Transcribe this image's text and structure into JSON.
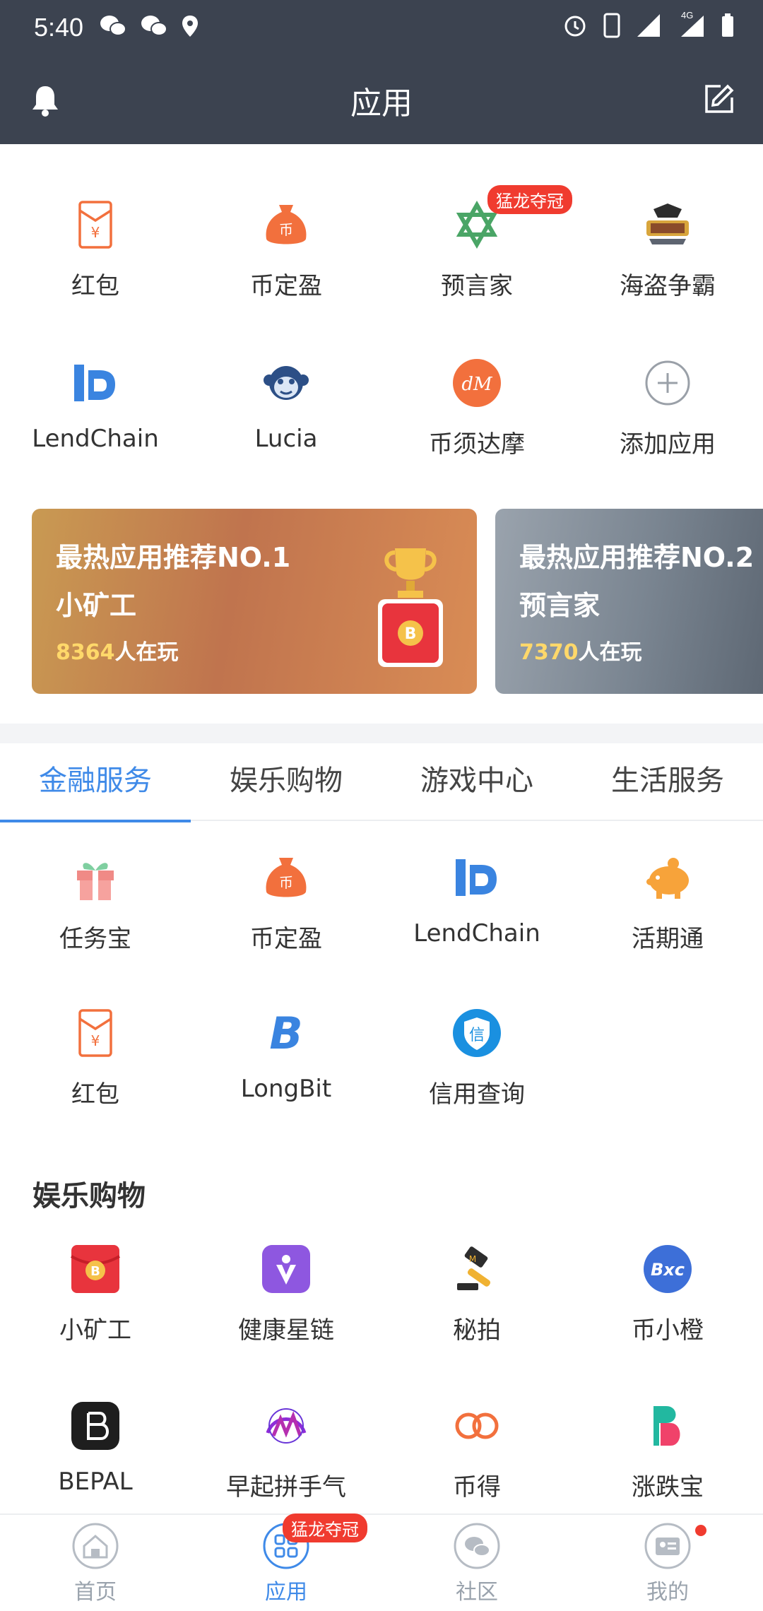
{
  "status_bar": {
    "time": "5:40",
    "network": "4G"
  },
  "app_bar": {
    "title": "应用"
  },
  "apps_top": [
    {
      "label": "红包",
      "icon": "red-envelope-icon"
    },
    {
      "label": "币定盈",
      "icon": "money-bag-icon"
    },
    {
      "label": "预言家",
      "icon": "star-of-david-icon",
      "badge": "猛龙夺冠"
    },
    {
      "label": "海盗争霸",
      "icon": "pirate-icon"
    },
    {
      "label": "LendChain",
      "icon": "lendchain-icon"
    },
    {
      "label": "Lucia",
      "icon": "monkey-icon"
    },
    {
      "label": "币须达摩",
      "icon": "dm-logo-icon"
    },
    {
      "label": "添加应用",
      "icon": "add-circle-icon"
    }
  ],
  "banners": [
    {
      "line1": "最热应用推荐NO.1",
      "line2": "小矿工",
      "count": "8364",
      "suffix": "人在玩"
    },
    {
      "line1": "最热应用推荐NO.2",
      "line2": "预言家",
      "count": "7370",
      "suffix": "人在玩"
    }
  ],
  "category_tabs": [
    {
      "label": "金融服务",
      "active": true
    },
    {
      "label": "娱乐购物",
      "active": false
    },
    {
      "label": "游戏中心",
      "active": false
    },
    {
      "label": "生活服务",
      "active": false
    }
  ],
  "finance_apps": [
    {
      "label": "任务宝",
      "icon": "gift-icon"
    },
    {
      "label": "币定盈",
      "icon": "money-bag-icon"
    },
    {
      "label": "LendChain",
      "icon": "lendchain-icon"
    },
    {
      "label": "活期通",
      "icon": "piggy-bank-icon"
    },
    {
      "label": "红包",
      "icon": "red-envelope-icon"
    },
    {
      "label": "LongBit",
      "icon": "longbit-icon"
    },
    {
      "label": "信用查询",
      "icon": "credit-shield-icon"
    }
  ],
  "entertainment_section": {
    "title": "娱乐购物",
    "apps": [
      {
        "label": "小矿工",
        "icon": "bitcoin-envelope-icon"
      },
      {
        "label": "健康星链",
        "icon": "health-chain-icon"
      },
      {
        "label": "秘拍",
        "icon": "auction-hammer-icon"
      },
      {
        "label": "币小橙",
        "icon": "bxc-icon"
      },
      {
        "label": "BEPAL",
        "icon": "bepal-icon"
      },
      {
        "label": "早起拼手气",
        "icon": "early-bird-icon"
      },
      {
        "label": "币得",
        "icon": "infinity-link-icon"
      },
      {
        "label": "涨跌宝",
        "icon": "updown-icon"
      }
    ]
  },
  "bottom_nav": [
    {
      "label": "首页",
      "icon": "home-icon"
    },
    {
      "label": "应用",
      "icon": "apps-icon",
      "badge": "猛龙夺冠",
      "active": true
    },
    {
      "label": "社区",
      "icon": "chat-icon"
    },
    {
      "label": "我的",
      "icon": "profile-card-icon",
      "dot": true
    }
  ],
  "colors": {
    "header": "#3c4350",
    "accent": "#3f8ae8",
    "badge": "#f03b2f",
    "orange": "#f2703d"
  }
}
